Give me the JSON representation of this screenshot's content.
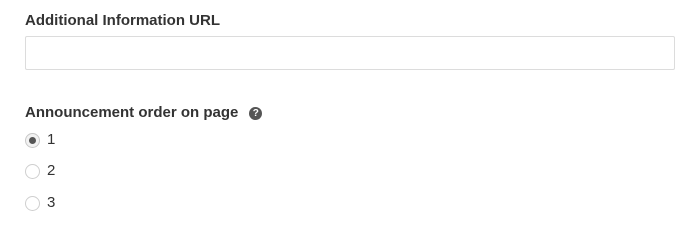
{
  "url_field": {
    "label": "Additional Information URL",
    "value": "",
    "placeholder": ""
  },
  "order_field": {
    "label": "Announcement order on page",
    "help_icon": "question-circle-icon",
    "options": [
      {
        "label": "1",
        "selected": true
      },
      {
        "label": "2",
        "selected": false
      },
      {
        "label": "3",
        "selected": false
      }
    ]
  }
}
